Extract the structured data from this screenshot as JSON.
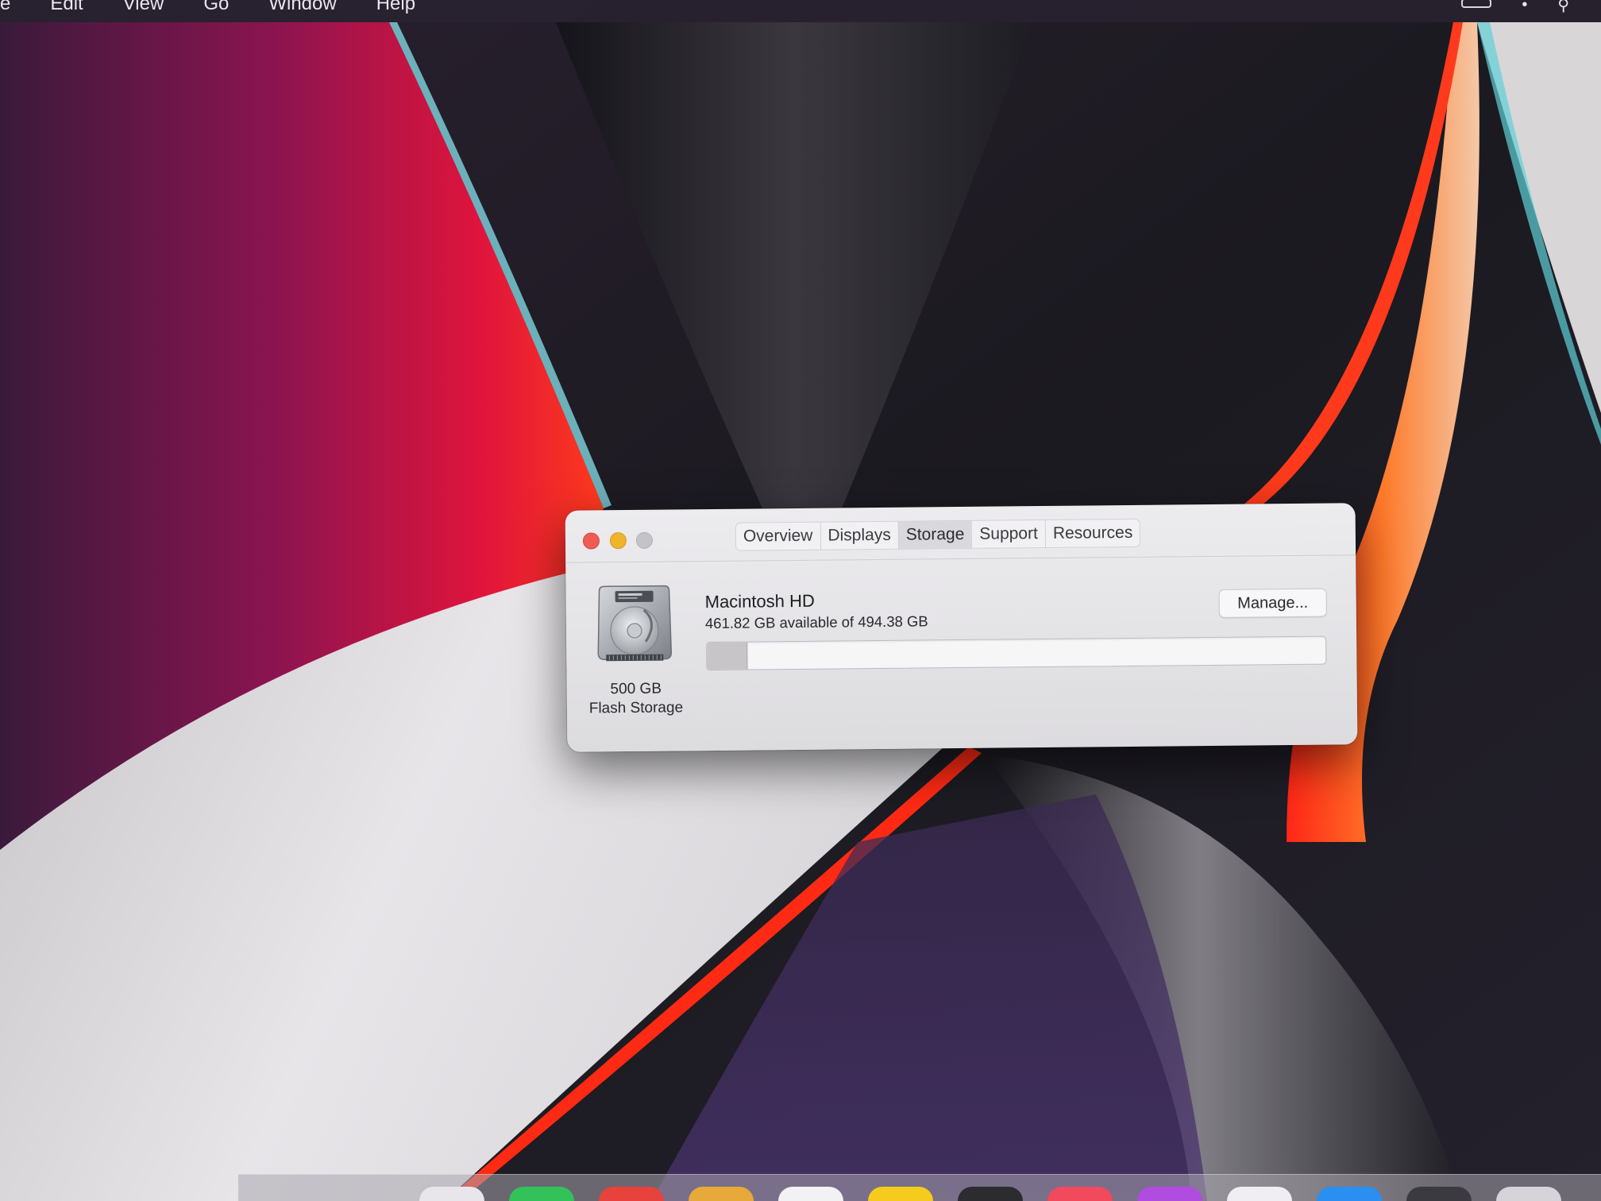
{
  "menubar": {
    "items": [
      "e",
      "Edit",
      "View",
      "Go",
      "Window",
      "Help"
    ]
  },
  "window": {
    "tabs": [
      "Overview",
      "Displays",
      "Storage",
      "Support",
      "Resources"
    ],
    "active_tab": "Storage"
  },
  "storage": {
    "disk_size": "500 GB",
    "disk_type": "Flash Storage",
    "volume_name": "Macintosh HD",
    "availability": "461.82 GB available of 494.38 GB",
    "manage_label": "Manage...",
    "available_gb": 461.82,
    "total_gb": 494.38
  },
  "colors": {
    "close": "#ee5c54",
    "minimize": "#f0b32c",
    "zoom": "#c4c3c7",
    "wallpaper_accent_red": "#ff2a1e",
    "wallpaper_accent_magenta": "#c0145a",
    "wallpaper_dark": "#1d1b22"
  },
  "dock": {
    "icons": [
      "app-icon-blank",
      "messages-icon",
      "mail-icon",
      "notes-icon",
      "calendar-icon",
      "notes-yellow-icon",
      "terminal-icon",
      "music-icon",
      "podcasts-icon",
      "photos-icon",
      "app-store-icon",
      "settings-icon",
      "trash-icon"
    ]
  }
}
